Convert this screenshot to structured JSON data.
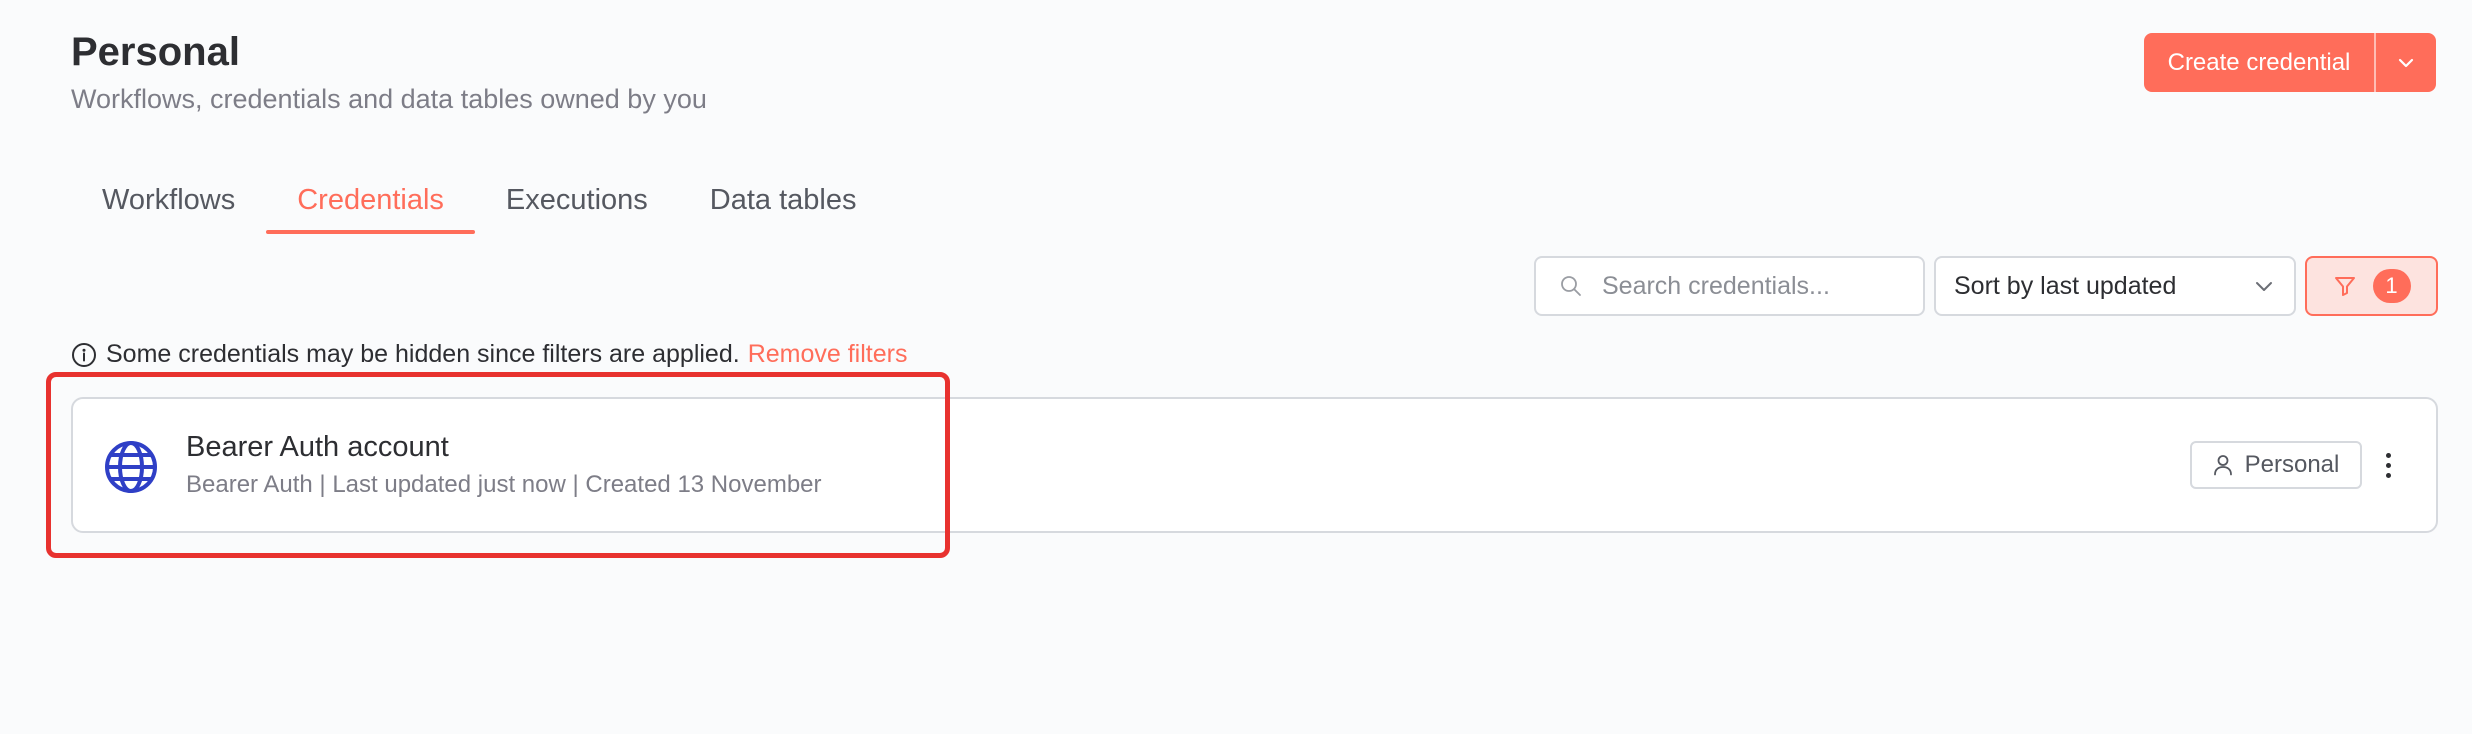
{
  "header": {
    "title": "Personal",
    "subtitle": "Workflows, credentials and data tables owned by you",
    "create_button_label": "Create credential",
    "create_button_menu_icon": "chevron-down-icon"
  },
  "tabs": [
    {
      "label": "Workflows",
      "active": false
    },
    {
      "label": "Credentials",
      "active": true
    },
    {
      "label": "Executions",
      "active": false
    },
    {
      "label": "Data tables",
      "active": false
    }
  ],
  "toolbar": {
    "search_placeholder": "Search credentials...",
    "search_icon": "search-icon",
    "sort_label": "Sort by last updated",
    "sort_icon": "chevron-down-icon",
    "filter_icon": "funnel-icon",
    "filter_count": "1"
  },
  "notice": {
    "text": "Some credentials may be hidden since filters are applied.",
    "link": "Remove filters",
    "icon": "info-icon"
  },
  "credentials": [
    {
      "name": "Bearer Auth account",
      "meta": "Bearer Auth | Last updated just now | Created 13 November",
      "icon": "globe-icon",
      "owner": "Personal",
      "owner_icon": "user-icon"
    }
  ],
  "colors": {
    "accent": "#ff6d5a",
    "globe": "#2f3fc6",
    "highlight": "#e8322f"
  }
}
